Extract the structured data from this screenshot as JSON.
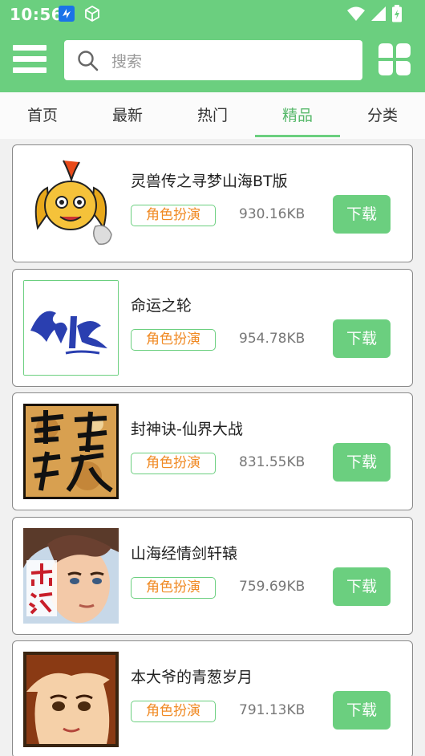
{
  "status": {
    "time": "10:56"
  },
  "search": {
    "placeholder": "搜索"
  },
  "tabs": [
    {
      "label": "首页"
    },
    {
      "label": "最新"
    },
    {
      "label": "热门"
    },
    {
      "label": "精品",
      "active": true
    },
    {
      "label": "分类"
    }
  ],
  "apps": [
    {
      "title": "灵兽传之寻梦山海BT版",
      "tag": "角色扮演",
      "size": "930.16KB",
      "download": "下载"
    },
    {
      "title": "命运之轮",
      "tag": "角色扮演",
      "size": "954.78KB",
      "download": "下载"
    },
    {
      "title": "封神诀-仙界大战",
      "tag": "角色扮演",
      "size": "831.55KB",
      "download": "下载"
    },
    {
      "title": "山海经情剑轩辕",
      "tag": "角色扮演",
      "size": "759.69KB",
      "download": "下载"
    },
    {
      "title": "本大爷的青葱岁月",
      "tag": "角色扮演",
      "size": "791.13KB",
      "download": "下载"
    }
  ],
  "theme": {
    "accent": "#6bcf7f",
    "tag_text": "#f08a24"
  }
}
